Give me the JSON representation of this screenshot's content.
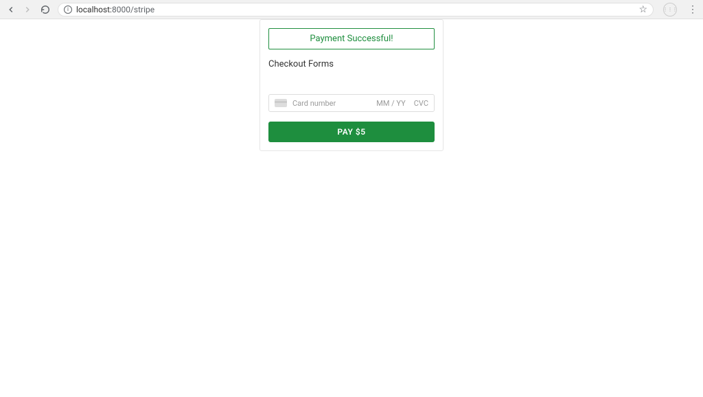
{
  "browser": {
    "url_host": "localhost:",
    "url_port_path": "8000/stripe"
  },
  "card": {
    "success_message": "Payment Successful!",
    "form_title": "Checkout Forms",
    "placeholders": {
      "card_number": "Card number",
      "expiry": "MM / YY",
      "cvc": "CVC"
    },
    "pay_button_label": "PAY $5"
  }
}
